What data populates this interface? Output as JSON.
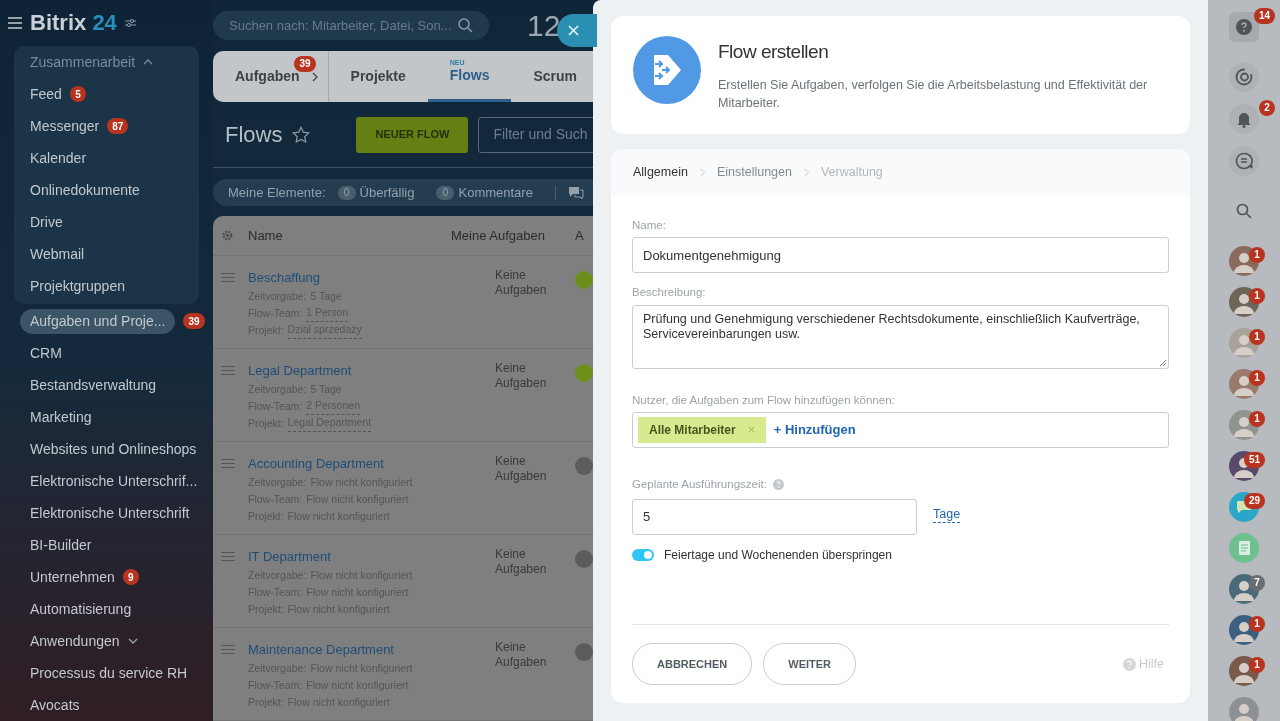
{
  "header": {
    "logo_text": "Bitrix",
    "logo_number": "24",
    "search_placeholder": "Suchen nach: Mitarbeiter, Datei, Son...",
    "clock": "12"
  },
  "sidebar": {
    "group": {
      "title": "Zusammenarbeit",
      "expanded": true,
      "items": [
        {
          "label": "Feed",
          "badge": "5",
          "selected": false
        },
        {
          "label": "Messenger",
          "badge": "87",
          "selected": false
        },
        {
          "label": "Kalender",
          "selected": false
        },
        {
          "label": "Onlinedokumente",
          "selected": false
        },
        {
          "label": "Drive",
          "selected": false
        },
        {
          "label": "Webmail",
          "selected": false
        },
        {
          "label": "Projektgruppen",
          "selected": false
        }
      ]
    },
    "items": [
      {
        "label": "Aufgaben und Proje...",
        "badge": "39",
        "selected": true
      },
      {
        "label": "CRM",
        "selected": false
      },
      {
        "label": "Bestandsverwaltung",
        "selected": false
      },
      {
        "label": "Marketing",
        "selected": false
      },
      {
        "label": "Websites und Onlineshops",
        "selected": false
      },
      {
        "label": "Elektronische Unterschrif...",
        "selected": false
      },
      {
        "label": "Elektronische Unterschrift",
        "selected": false
      },
      {
        "label": "BI-Builder",
        "selected": false
      },
      {
        "label": "Unternehmen",
        "badge": "9",
        "selected": false
      },
      {
        "label": "Automatisierung",
        "selected": false
      },
      {
        "label": "Anwendungen",
        "expanded": false,
        "selected": false
      },
      {
        "label": "Processus du service RH",
        "selected": false
      },
      {
        "label": "Avocats",
        "selected": false
      }
    ]
  },
  "tabs": [
    {
      "label": "Aufgaben",
      "badge": "39",
      "selected": false
    },
    {
      "label": "Projekte",
      "selected": false
    },
    {
      "label": "Flows",
      "tag": "NEU",
      "selected": true
    },
    {
      "label": "Scrum",
      "selected": false
    }
  ],
  "toolbar": {
    "title": "Flows",
    "button": "NEUER FLOW",
    "filter_placeholder": "Filter und Such"
  },
  "counters": {
    "label": "Meine Elemente:",
    "items": [
      {
        "count": "0",
        "label": "Überfällig"
      },
      {
        "count": "0",
        "label": "Kommentare"
      }
    ]
  },
  "table": {
    "columns": [
      "Name",
      "Meine Aufgaben",
      "A"
    ],
    "rows": [
      {
        "name": "Beschaffung",
        "tasks": "Keine Aufgaben",
        "color": "#6f8f1c",
        "details": [
          {
            "label": "Zeitvorgabe:",
            "value": "5 Tage",
            "link": false
          },
          {
            "label": "Flow-Team:",
            "value": "1 Person",
            "link": true
          },
          {
            "label": "Projekt:",
            "value": "Dział sprzedaży",
            "link": true
          }
        ]
      },
      {
        "name": "Legal Department",
        "tasks": "Keine Aufgaben",
        "color": "#6f8f1c",
        "details": [
          {
            "label": "Zeitvorgabe:",
            "value": "5 Tage",
            "link": false
          },
          {
            "label": "Flow-Team:",
            "value": "2 Personen",
            "link": true
          },
          {
            "label": "Projekt:",
            "value": "Legal Department",
            "link": true
          }
        ]
      },
      {
        "name": "Accounting Department",
        "tasks": "Keine Aufgaben",
        "color": "#5c5c5c",
        "details": [
          {
            "label": "Zeitvorgabe:",
            "value": "Flow nicht konfiguriert",
            "link": false
          },
          {
            "label": "Flow-Team:",
            "value": "Flow nicht konfiguriert",
            "link": false
          },
          {
            "label": "Projekt:",
            "value": "Flow nicht konfiguriert",
            "link": false
          }
        ]
      },
      {
        "name": "IT Department",
        "tasks": "Keine Aufgaben",
        "color": "#5c5c5c",
        "details": [
          {
            "label": "Zeitvorgabe:",
            "value": "Flow nicht konfiguriert",
            "link": false
          },
          {
            "label": "Flow-Team:",
            "value": "Flow nicht konfiguriert",
            "link": false
          },
          {
            "label": "Projekt:",
            "value": "Flow nicht konfiguriert",
            "link": false
          }
        ]
      },
      {
        "name": "Maintenance Department",
        "tasks": "Keine Aufgaben",
        "color": "#5c5c5c",
        "details": [
          {
            "label": "Zeitvorgabe:",
            "value": "Flow nicht konfiguriert",
            "link": false
          },
          {
            "label": "Flow-Team:",
            "value": "Flow nicht konfiguriert",
            "link": false
          },
          {
            "label": "Projekt:",
            "value": "Flow nicht konfiguriert",
            "link": false
          }
        ]
      }
    ]
  },
  "panel": {
    "title": "Flow erstellen",
    "description": "Erstellen Sie Aufgaben, verfolgen Sie die Arbeitsbelastung und Effektivität der Mitarbeiter.",
    "steps": [
      {
        "label": "Allgemein",
        "selected": true,
        "disabled": false
      },
      {
        "label": "Einstellungen",
        "selected": false,
        "disabled": false
      },
      {
        "label": "Verwaltung",
        "selected": false,
        "disabled": true
      }
    ],
    "name": {
      "label": "Name:",
      "value": "Dokumentgenehmigung"
    },
    "description_field": {
      "label": "Beschreibung:",
      "value": "Prüfung und Genehmigung verschiedener Rechtsdokumente, einschließlich Kaufverträge, Servicevereinbarungen usw."
    },
    "users": {
      "label": "Nutzer, die Aufgaben zum Flow hinzufügen können:",
      "tags": [
        "Alle Mitarbeiter"
      ],
      "add": "+ Hinzufügen"
    },
    "time": {
      "label": "Geplante Ausführungszeit:",
      "value": "5",
      "unit": "Tage"
    },
    "skip": {
      "label": "Feiertage und Wochenenden überspringen",
      "on": true
    },
    "buttons": [
      "ABBRECHEN",
      "WEITER"
    ],
    "help": "Hilfe"
  },
  "rightbar": {
    "tools": [
      {
        "kind": "help",
        "badge": "14"
      },
      {
        "kind": "copilot"
      },
      {
        "kind": "bell",
        "badge": "2"
      },
      {
        "kind": "chat"
      },
      {
        "kind": "search"
      }
    ],
    "contacts": [
      {
        "kind": "avatar",
        "badge": "1",
        "muted": false,
        "color": "#8a6a5c"
      },
      {
        "kind": "avatar",
        "badge": "1",
        "muted": false,
        "color": "#6f6458"
      },
      {
        "kind": "avatar",
        "badge": "1",
        "muted": false,
        "color": "#a8a29a"
      },
      {
        "kind": "avatar",
        "badge": "1",
        "muted": false,
        "color": "#9a7a6a"
      },
      {
        "kind": "avatar",
        "badge": "1",
        "muted": false,
        "color": "#8f948f"
      },
      {
        "kind": "avatar",
        "badge": "51",
        "muted": false,
        "color": "#5a4a6a"
      },
      {
        "kind": "chat",
        "badge": "29",
        "muted": false,
        "color": "#2aa6c8"
      },
      {
        "kind": "document",
        "color": "#6fbf8f"
      },
      {
        "kind": "avatar",
        "badge": "7",
        "muted": true,
        "color": "#4a6a7a"
      },
      {
        "kind": "avatar",
        "badge": "1",
        "muted": false,
        "color": "#3d5f80"
      },
      {
        "kind": "avatar",
        "badge": "1",
        "muted": false,
        "color": "#7a5a4a"
      },
      {
        "kind": "avatar",
        "color": "#8d9094"
      }
    ]
  }
}
